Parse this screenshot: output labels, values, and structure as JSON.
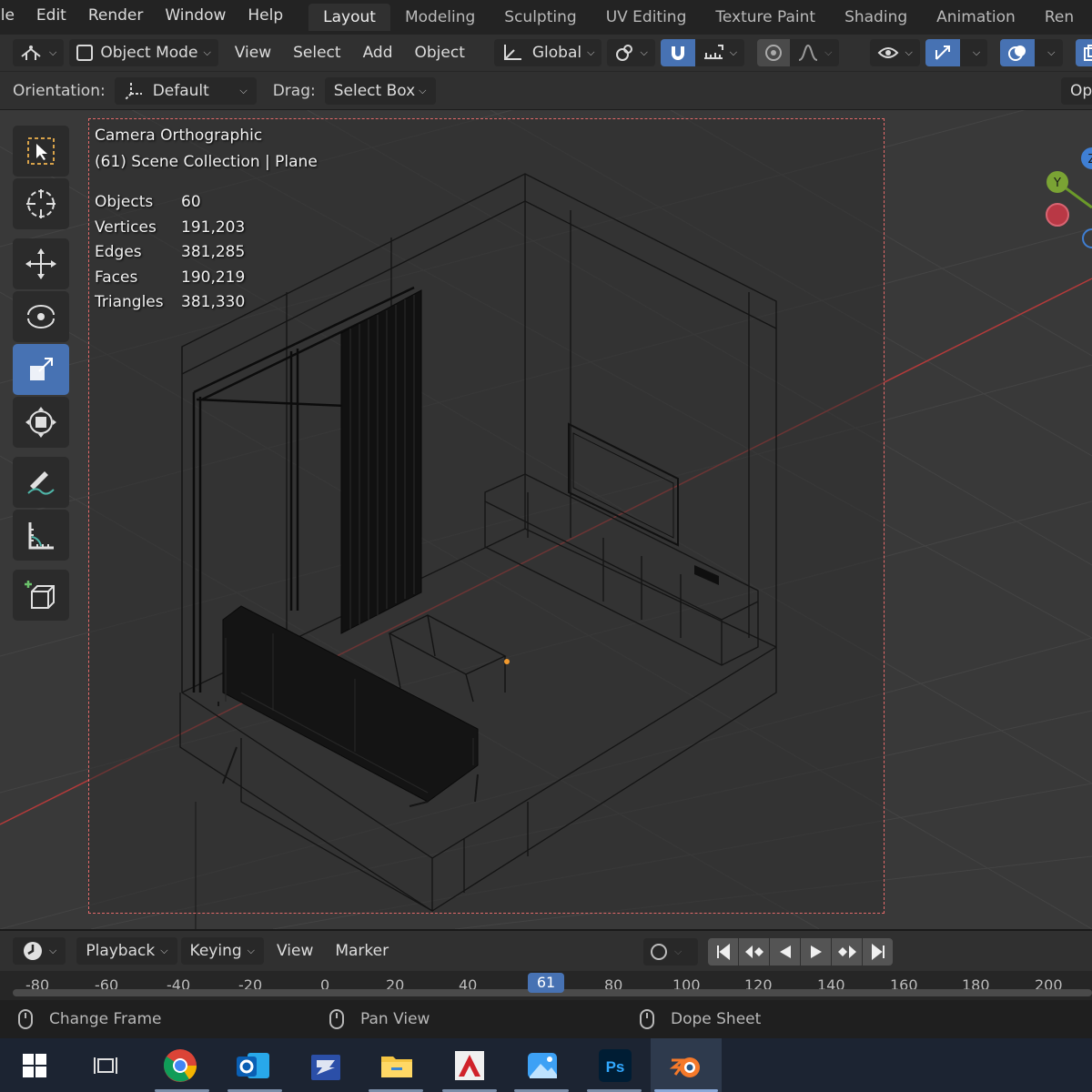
{
  "menubar": {
    "items": [
      "ile",
      "Edit",
      "Render",
      "Window",
      "Help"
    ],
    "workspaces": [
      "Layout",
      "Modeling",
      "Sculpting",
      "UV Editing",
      "Texture Paint",
      "Shading",
      "Animation",
      "Ren"
    ],
    "active_workspace": "Layout"
  },
  "header": {
    "mode": "Object Mode",
    "menus": [
      "View",
      "Select",
      "Add",
      "Object"
    ],
    "transform_orientation": "Global",
    "overlay_partial": "Op"
  },
  "tool_settings": {
    "orientation_label": "Orientation:",
    "orientation_value": "Default",
    "drag_label": "Drag:",
    "drag_value": "Select Box"
  },
  "viewport": {
    "camera_title": "Camera Orthographic",
    "collection": "(61) Scene Collection | Plane",
    "stats": [
      {
        "key": "Objects",
        "value": "60"
      },
      {
        "key": "Vertices",
        "value": "191,203"
      },
      {
        "key": "Edges",
        "value": "381,285"
      },
      {
        "key": "Faces",
        "value": "190,219"
      },
      {
        "key": "Triangles",
        "value": "381,330"
      }
    ],
    "gizmo": {
      "y_label": "Y",
      "z_label": "Z"
    },
    "colors": {
      "background": "#393939",
      "camera_frame": "#e46a6a",
      "x_axis": "#b33a3a",
      "active_tool": "#4772b3"
    }
  },
  "toolbar": {
    "tools": [
      "select-box",
      "cursor",
      "move",
      "rotate",
      "scale",
      "transform",
      "annotate",
      "measure",
      "add-cube"
    ],
    "active_tool": "scale"
  },
  "timeline": {
    "menus": [
      "Playback",
      "Keying",
      "View",
      "Marker"
    ],
    "frame_ticks": [
      "-80",
      "-60",
      "-40",
      "-20",
      "0",
      "20",
      "40",
      "61",
      "80",
      "100",
      "120",
      "140",
      "160",
      "180",
      "200"
    ],
    "current_frame": "61"
  },
  "statusbar": {
    "items": [
      "Change Frame",
      "Pan View",
      "Dope Sheet"
    ]
  },
  "taskbar": {
    "apps": [
      "windows-start",
      "task-view",
      "chrome",
      "outlook",
      "app-store",
      "file-explorer",
      "autocad",
      "photos",
      "photoshop",
      "blender"
    ],
    "photoshop_label": "Ps"
  }
}
